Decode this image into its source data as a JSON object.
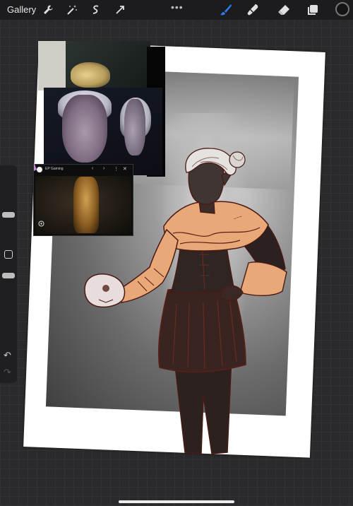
{
  "toolbar": {
    "gallery_label": "Gallery",
    "tools_left": [
      "wrench-icon",
      "magic-wand-icon",
      "selection-icon",
      "transform-icon"
    ],
    "tools_right": [
      "brush-icon",
      "smudge-icon",
      "eraser-icon",
      "layers-icon"
    ],
    "more_dots": "•••",
    "active_tool": "brush",
    "accent_color": "#2b7ff5",
    "current_color": "#141414"
  },
  "video_overlay": {
    "channel": "EP Gaming",
    "controls": [
      "‹",
      "›",
      "⋮",
      "✕"
    ]
  },
  "sidebar": {
    "size_slider_level": 0.78,
    "opacity_slider_level": 0.55,
    "modify_button": "square-button",
    "undo_icon": "↶",
    "redo_icon": "↷"
  },
  "colors": {
    "armor_fill": "#e9a878",
    "sketch_line": "#4a1a14",
    "body_fill": "#2d221f"
  }
}
